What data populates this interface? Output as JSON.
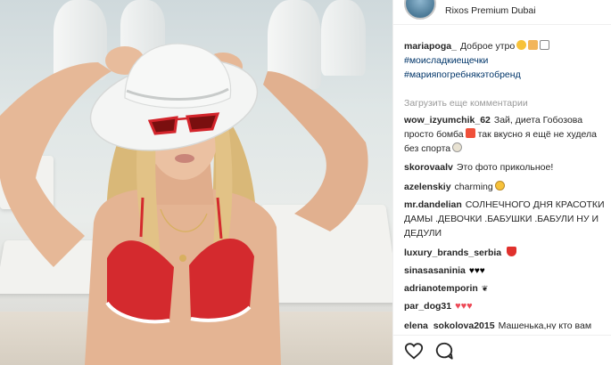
{
  "post": {
    "location": "Rixos Premium Dubai"
  },
  "caption": {
    "username": "mariapoga_",
    "text": "Доброе утро",
    "hashtags": [
      "#моисладкиещечки",
      "#марияпогребнякэтобренд"
    ]
  },
  "load_more_label": "Загрузить еще комментарии",
  "comments": [
    {
      "username": "wow_izyumchik_62",
      "text": "Зай, диета Гобозова просто бомба",
      "text_cont": "так вкусно я ещё не худела без спорта"
    },
    {
      "username": "skorovaalv",
      "text": "Это фото прикольное!"
    },
    {
      "username": "azelenskiy",
      "text": "charming"
    },
    {
      "username": "mr.dandelian",
      "text": "СОЛНЕЧНОГО ДНЯ КРАСОТКИ ДАМЫ .ДЕВОЧКИ .БАБУШКИ .БАБУЛИ НУ И ДЕДУЛИ"
    },
    {
      "username": "luxury_brands_serbia",
      "text": ""
    },
    {
      "username": "sinasasaninia",
      "text": "♥♥♥"
    },
    {
      "username": "adrianotemporin",
      "text": ""
    },
    {
      "username": "par_dog31",
      "text": "♥♥♥"
    },
    {
      "username": "elena_sokolova2015",
      "text": "Машенька,ну кто вам"
    }
  ],
  "icons": {
    "like": "heart-outline-icon",
    "comment": "comment-bubble-icon"
  },
  "colors": {
    "hashtag": "#003569",
    "muted": "#999999",
    "heart": "#ed4956"
  }
}
